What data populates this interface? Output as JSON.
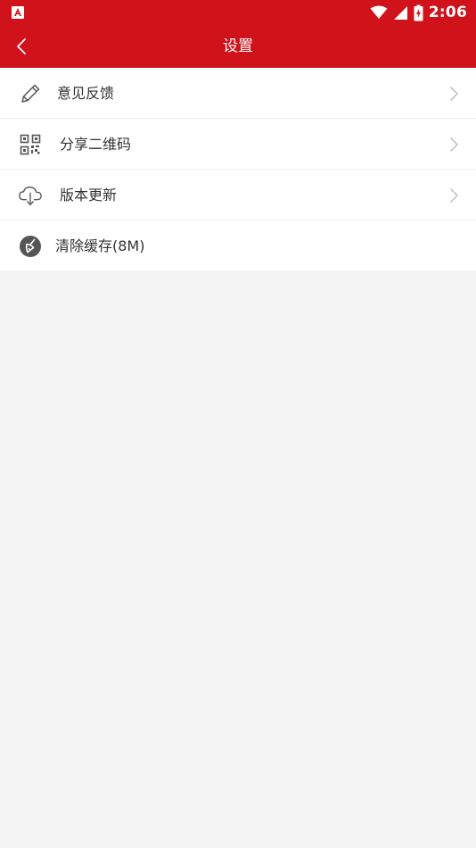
{
  "status_bar": {
    "time": "2:06",
    "icons": [
      "app-notification-icon",
      "wifi-icon",
      "signal-icon",
      "battery-icon"
    ]
  },
  "header": {
    "title": "设置",
    "back_icon": "back-chevron-icon"
  },
  "settings": {
    "items": [
      {
        "label": "意见反馈",
        "icon": "pencil-icon",
        "has_arrow": true
      },
      {
        "label": "分享二维码",
        "icon": "qr-code-icon",
        "has_arrow": true
      },
      {
        "label": "版本更新",
        "icon": "cloud-download-icon",
        "has_arrow": true
      },
      {
        "label": "清除缓存(8M)",
        "icon": "broom-icon",
        "has_arrow": false
      }
    ]
  },
  "colors": {
    "brand": "#d0121b",
    "background": "#f4f4f4",
    "text": "#333333",
    "chevron": "#c4c4c4"
  }
}
